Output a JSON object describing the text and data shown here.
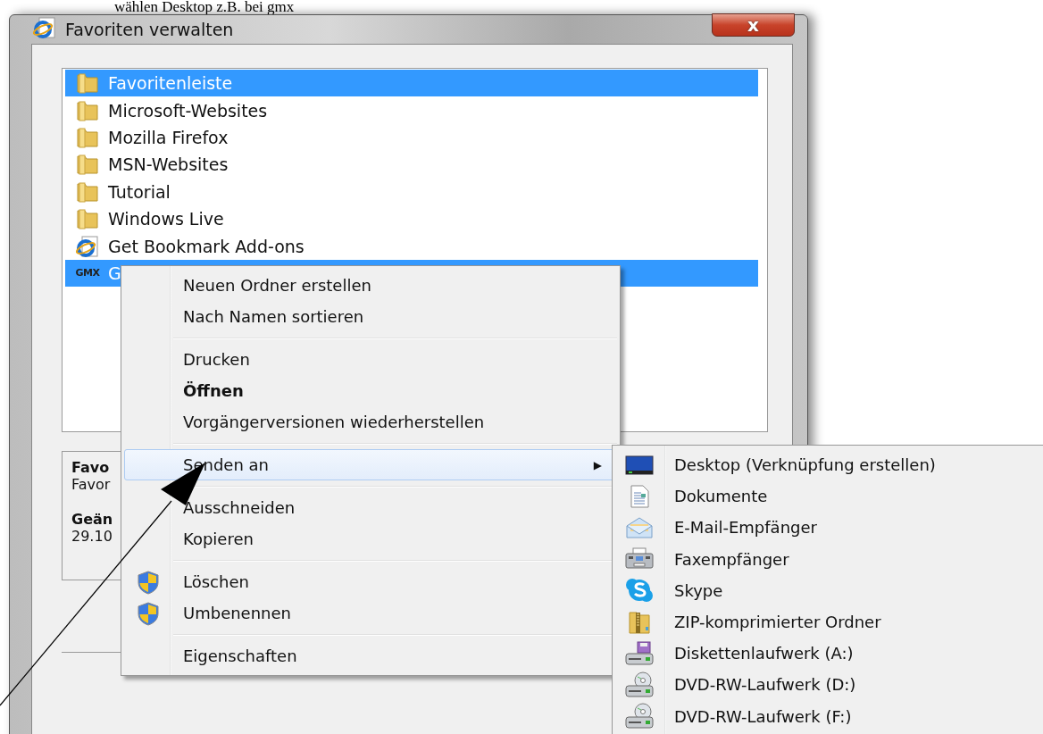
{
  "document_text": "wählen Desktop z.B. bei gmx",
  "window": {
    "title": "Favoriten verwalten",
    "close_label": "x"
  },
  "favorites": [
    {
      "label": "Favoritenleiste",
      "kind": "folder",
      "selected": true
    },
    {
      "label": "Microsoft-Websites",
      "kind": "folder",
      "selected": false
    },
    {
      "label": "Mozilla Firefox",
      "kind": "folder",
      "selected": false
    },
    {
      "label": "MSN-Websites",
      "kind": "folder",
      "selected": false
    },
    {
      "label": "Tutorial",
      "kind": "folder",
      "selected": false
    },
    {
      "label": "Windows Live",
      "kind": "folder",
      "selected": false
    },
    {
      "label": "Get Bookmark Add-ons",
      "kind": "link",
      "selected": false
    },
    {
      "label": "G",
      "kind": "gmx",
      "icon_text": "GMX",
      "selected": true
    }
  ],
  "details": [
    {
      "text": "Favo",
      "bold": true
    },
    {
      "text": "Favor",
      "bold": false
    },
    {
      "text": "Geän",
      "bold": true
    },
    {
      "text": "29.10",
      "bold": false
    }
  ],
  "context_menu": [
    {
      "kind": "item",
      "label": "Neuen Ordner erstellen",
      "bold": false,
      "highlighted": false,
      "submenu": false
    },
    {
      "kind": "item",
      "label": "Nach Namen sortieren",
      "bold": false,
      "highlighted": false,
      "submenu": false
    },
    {
      "kind": "separator"
    },
    {
      "kind": "item",
      "label": "Drucken",
      "bold": false,
      "highlighted": false,
      "submenu": false
    },
    {
      "kind": "item",
      "label": "Öffnen",
      "bold": true,
      "highlighted": false,
      "submenu": false
    },
    {
      "kind": "item",
      "label": "Vorgängerversionen wiederherstellen",
      "bold": false,
      "highlighted": false,
      "submenu": false
    },
    {
      "kind": "separator"
    },
    {
      "kind": "item",
      "label": "Senden an",
      "bold": false,
      "highlighted": true,
      "submenu": true,
      "submenu_arrow": "▶"
    },
    {
      "kind": "separator"
    },
    {
      "kind": "item",
      "label": "Ausschneiden",
      "bold": false,
      "highlighted": false,
      "submenu": false
    },
    {
      "kind": "item",
      "label": "Kopieren",
      "bold": false,
      "highlighted": false,
      "submenu": false
    },
    {
      "kind": "separator"
    },
    {
      "kind": "shield",
      "label": "Löschen",
      "bold": false,
      "highlighted": false,
      "submenu": false
    },
    {
      "kind": "shield",
      "label": "Umbenennen",
      "bold": false,
      "highlighted": false,
      "submenu": false
    },
    {
      "kind": "separator"
    },
    {
      "kind": "item",
      "label": "Eigenschaften",
      "bold": false,
      "highlighted": false,
      "submenu": false
    }
  ],
  "send_to_menu": [
    {
      "label": "Desktop (Verknüpfung erstellen)",
      "kind": "desktop"
    },
    {
      "label": "Dokumente",
      "kind": "document"
    },
    {
      "label": "E-Mail-Empfänger",
      "kind": "mail"
    },
    {
      "label": "Faxempfänger",
      "kind": "fax"
    },
    {
      "label": "Skype",
      "kind": "skype"
    },
    {
      "label": "ZIP-komprimierter Ordner",
      "kind": "zip"
    },
    {
      "label": "Diskettenlaufwerk (A:)",
      "kind": "floppy"
    },
    {
      "label": "DVD-RW-Laufwerk (D:)",
      "kind": "dvd"
    },
    {
      "label": "DVD-RW-Laufwerk (F:)",
      "kind": "dvd"
    }
  ]
}
